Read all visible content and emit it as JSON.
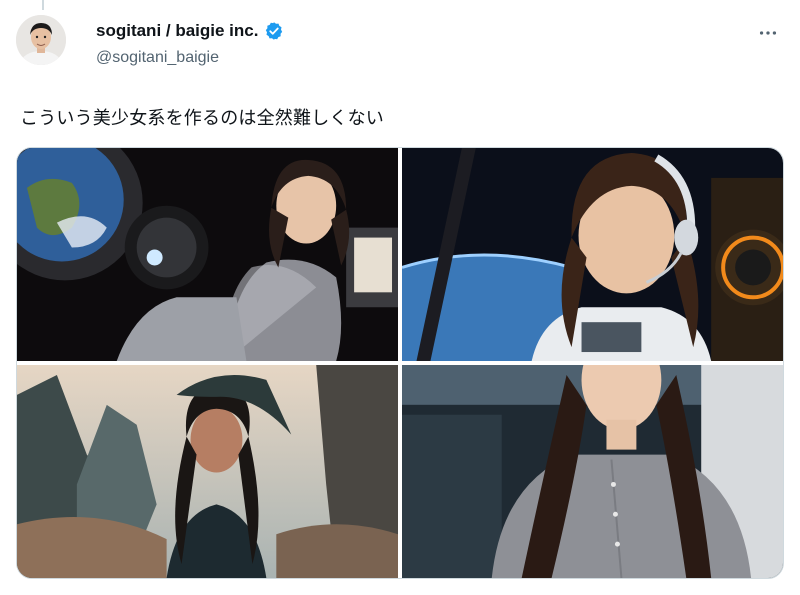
{
  "tweet": {
    "display_name": "sogitani / baigie inc.",
    "handle": "@sogitani_baigie",
    "text": "こういう美少女系を作るのは全然難しくない",
    "verified": true
  },
  "icons": {
    "verified": "verified-badge-icon",
    "more": "more-options-icon"
  },
  "colors": {
    "verified_blue": "#1d9bf0",
    "secondary_text": "#536471",
    "border": "#cfd9de"
  },
  "media": [
    {
      "description": "astronaut-style woman beside earth window"
    },
    {
      "description": "woman with headset in spaceship"
    },
    {
      "description": "fantasy woman in canyon landscape"
    },
    {
      "description": "woman in grey shirt in office"
    }
  ]
}
